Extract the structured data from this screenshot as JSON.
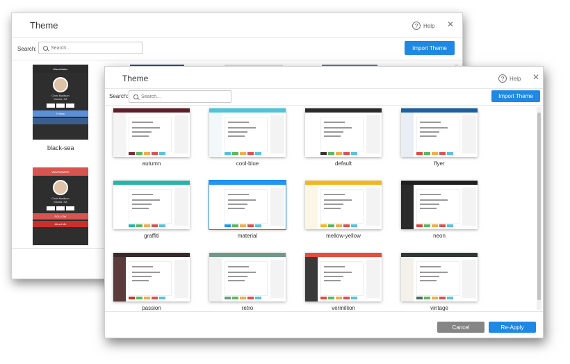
{
  "back_dialog": {
    "title": "Theme",
    "help": "Help",
    "close": "✕",
    "search_label": "Search:",
    "search_placeholder": "Search...",
    "import_label": "Import Theme",
    "cards": [
      {
        "name": "black-sea",
        "app": "WaveMaker",
        "person": "Chris Madison",
        "location": "Manila, SA",
        "action": "Follow",
        "accent": "#5b8fd6",
        "header": "#2b2b2b"
      },
      {
        "name": "",
        "app": "WAVEMAKER",
        "person": "Chris Madison",
        "location": "Manila, SA",
        "action": "FOLLOW",
        "accent": "#d9534f",
        "header": "#d9534f",
        "extra": "About Me"
      }
    ]
  },
  "front_dialog": {
    "title": "Theme",
    "help": "Help",
    "close": "✕",
    "search_label": "Search:",
    "search_placeholder": "Search...",
    "import_label": "Import Theme",
    "themes": [
      {
        "name": "autumn",
        "header": "#5c1f2a",
        "side": "#f4f4f4",
        "accent": "#7b2b36"
      },
      {
        "name": "cool-blue",
        "header": "#4fc3d8",
        "side": "#f2f7f9",
        "accent": "#4fc3d8"
      },
      {
        "name": "default",
        "header": "#2a2a2a",
        "side": "#ffffff",
        "accent": "#333333"
      },
      {
        "name": "flyer",
        "header": "#1c5f9c",
        "side": "#e9eef5",
        "accent": "#e04b3f"
      },
      {
        "name": "graffiti",
        "header": "#2ab3a8",
        "side": "#ffffff",
        "accent": "#2ab3a8"
      },
      {
        "name": "material",
        "header": "#2196f3",
        "side": "#ffffff",
        "accent": "#2196f3",
        "selected": true
      },
      {
        "name": "mellow-yellow",
        "header": "#f3b61f",
        "side": "#fbf6e6",
        "accent": "#f3b61f"
      },
      {
        "name": "neon",
        "header": "#1f1f1f",
        "side": "#2b2b2b",
        "accent": "#e0433a"
      },
      {
        "name": "passion",
        "header": "#3a2b2b",
        "side": "#5a3a3a",
        "accent": "#c0392b"
      },
      {
        "name": "retro",
        "header": "#6f9a86",
        "side": "#f2f2f2",
        "accent": "#6f9a86"
      },
      {
        "name": "vermillion",
        "header": "#e94b3c",
        "side": "#3a3a3a",
        "accent": "#e94b3c"
      },
      {
        "name": "vintage",
        "header": "#2f3a36",
        "side": "#f3f1ea",
        "accent": "#4e6b5c"
      }
    ],
    "cancel_label": "Cancel",
    "reapply_label": "Re-Apply"
  },
  "colors": {
    "primary": "#1e88e5",
    "secondary": "#858585"
  }
}
